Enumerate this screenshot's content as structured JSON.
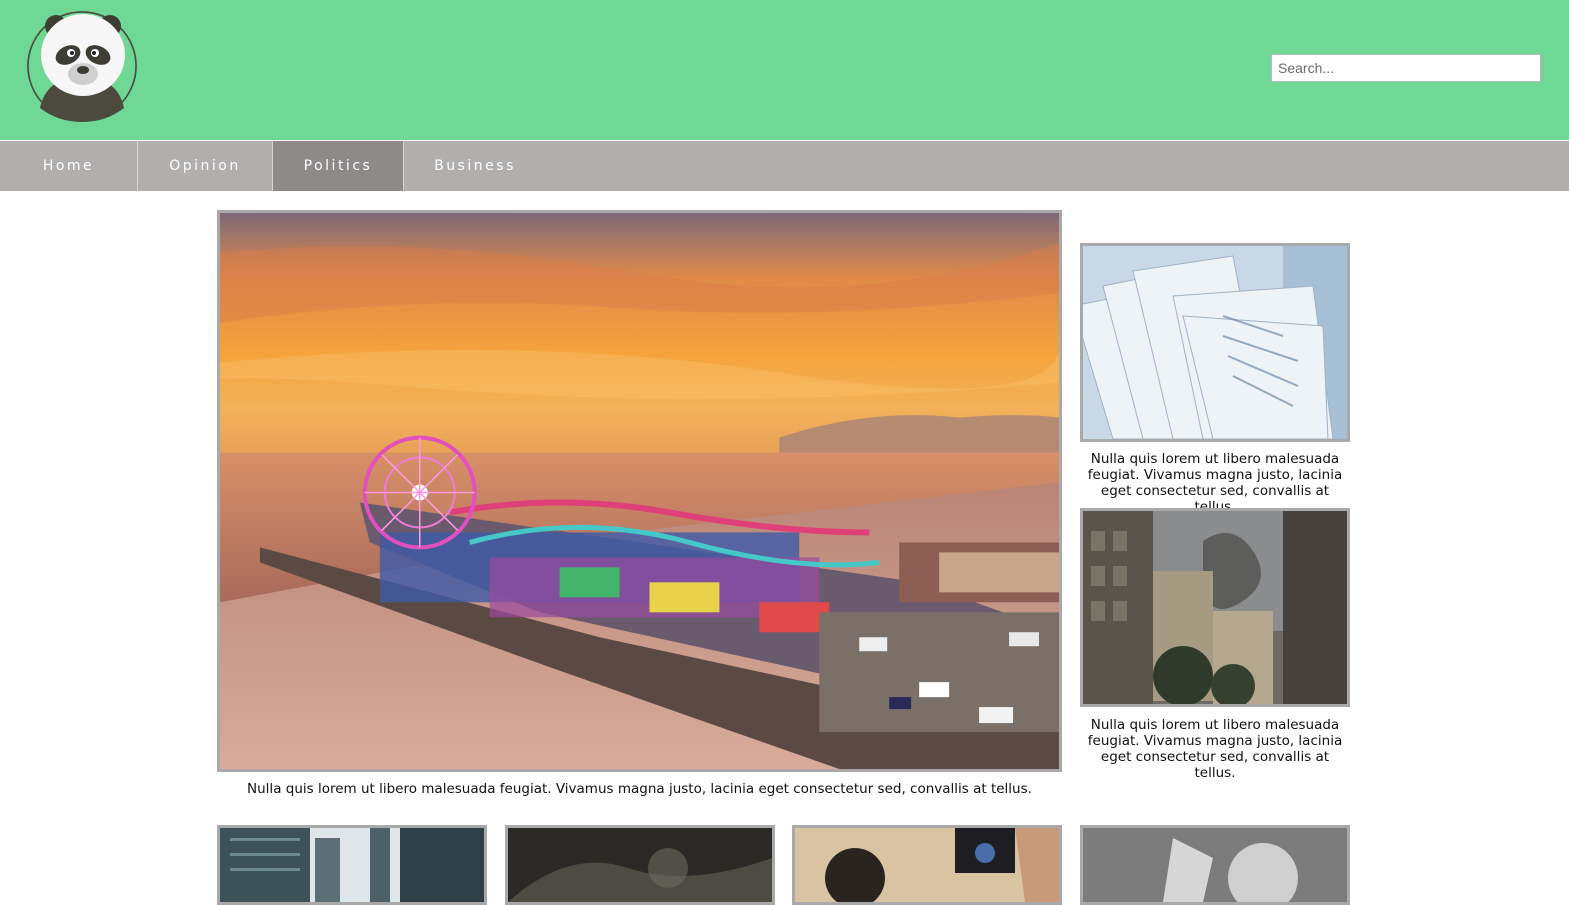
{
  "header": {
    "logo_icon": "panda-logo-icon",
    "search": {
      "placeholder": "Search...",
      "value": ""
    }
  },
  "nav": {
    "items": [
      {
        "label": "Home",
        "active": false
      },
      {
        "label": "Opinion",
        "active": false
      },
      {
        "label": "Politics",
        "active": true
      },
      {
        "label": "Business",
        "active": false
      }
    ]
  },
  "colors": {
    "header_bg": "#6fd894",
    "nav_bg": "#b1aeae",
    "nav_active": "#8f8a8a",
    "card_border": "#a9a9a9"
  },
  "main_story": {
    "image": "santa-monica-pier-sunset-photo",
    "caption": "Nulla quis lorem ut libero malesuada feugiat. Vivamus magna justo, lacinia eget consectetur sed, convallis at tellus."
  },
  "side_stories": [
    {
      "image": "newspapers-business-photo",
      "caption": "Nulla quis lorem ut libero malesuada feugiat. Vivamus magna justo, lacinia eget consectetur sed, convallis at tellus."
    },
    {
      "image": "smoky-city-street-photo",
      "caption": "Nulla quis lorem ut libero malesuada feugiat. Vivamus magna justo, lacinia eget consectetur sed, convallis at tellus."
    }
  ],
  "bottom_thumbnails": [
    {
      "image": "city-skyscrapers-photo"
    },
    {
      "image": "dark-smoke-photo"
    },
    {
      "image": "crowd-camera-photo"
    },
    {
      "image": "grayscale-person-photo"
    }
  ]
}
